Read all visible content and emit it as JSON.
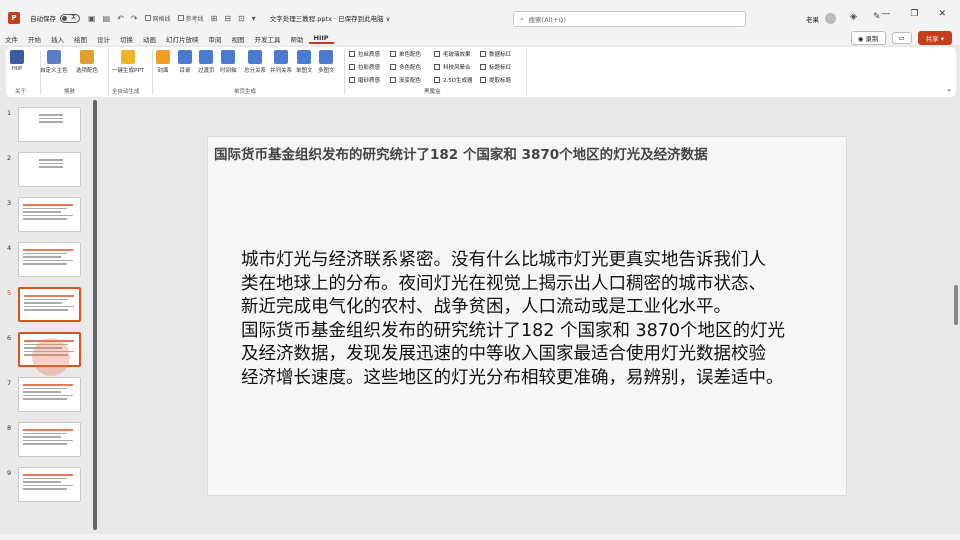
{
  "titlebar": {
    "autosave_label": "自动保存",
    "autosave_state": "关",
    "qat_checkbox_1": "网格线",
    "qat_checkbox_2": "参考线",
    "doc_title": "文字处理三教程.pptx · 已保存到此电脑 ∨",
    "search_placeholder": "搜索(Alt+Q)",
    "user_name": "老果"
  },
  "tabs": [
    "文件",
    "开始",
    "插入",
    "绘图",
    "设计",
    "切换",
    "动画",
    "幻灯片放映",
    "审阅",
    "视图",
    "开发工具",
    "帮助",
    "HIIP"
  ],
  "active_tab": "HIIP",
  "tab_right": {
    "record": "录制",
    "share": "共享"
  },
  "ribbon": {
    "buttons": [
      {
        "label": "HIIP",
        "color": "#3b5ba5"
      },
      {
        "label": "自定义主色",
        "color": "#5b7fc7"
      },
      {
        "label": "选项配色",
        "color": "#e0a030"
      },
      {
        "label": "一键生成PPT",
        "color": "#f0b429"
      },
      {
        "label": "封面",
        "color": "#f0a020"
      },
      {
        "label": "目录",
        "color": "#4a7bd0"
      },
      {
        "label": "过渡页",
        "color": "#4a7bd0"
      },
      {
        "label": "时间轴",
        "color": "#4a7bd0"
      },
      {
        "label": "总分关系",
        "color": "#4a7bd0"
      },
      {
        "label": "并列关系",
        "color": "#4a7bd0"
      },
      {
        "label": "单图文",
        "color": "#4a7bd0"
      },
      {
        "label": "多图文",
        "color": "#4a7bd0"
      }
    ],
    "groups": [
      "关于",
      "换肤",
      "全自动生成",
      "单页生成",
      "黑魔盒"
    ],
    "magic_box": [
      [
        "拉丝质感",
        "单色配色",
        "毛玻璃效果",
        "数据标红"
      ],
      [
        "拉影质感",
        "多色配色",
        "科技风晕合",
        "标题标红"
      ],
      [
        "磨砂质感",
        "渐变配色",
        "2.5D生成器",
        "提取标题"
      ]
    ]
  },
  "thumbnails": [
    "1",
    "2",
    "3",
    "4",
    "5",
    "6",
    "7",
    "8",
    "9"
  ],
  "selected_slide": "5",
  "slide": {
    "title": "国际货币基金组织发布的研究统计了182 个国家和 3870个地区的灯光及经济数据",
    "body_lines": [
      "城市灯光与经济联系紧密。没有什么比城市灯光更真实地告诉我们人",
      "类在地球上的分布。夜间灯光在视觉上揭示出人口稠密的城市状态、",
      "新近完成电气化的农村、战争贫困，人口流动或是工业化水平。",
      "国际货币基金组织发布的研究统计了182 个国家和 3870个地区的灯光",
      "及经济数据，发现发展迅速的中等收入国家最适合使用灯光数据校验",
      "经济增长速度。这些地区的灯光分布相较更准确，易辨别，误差适中。"
    ]
  }
}
